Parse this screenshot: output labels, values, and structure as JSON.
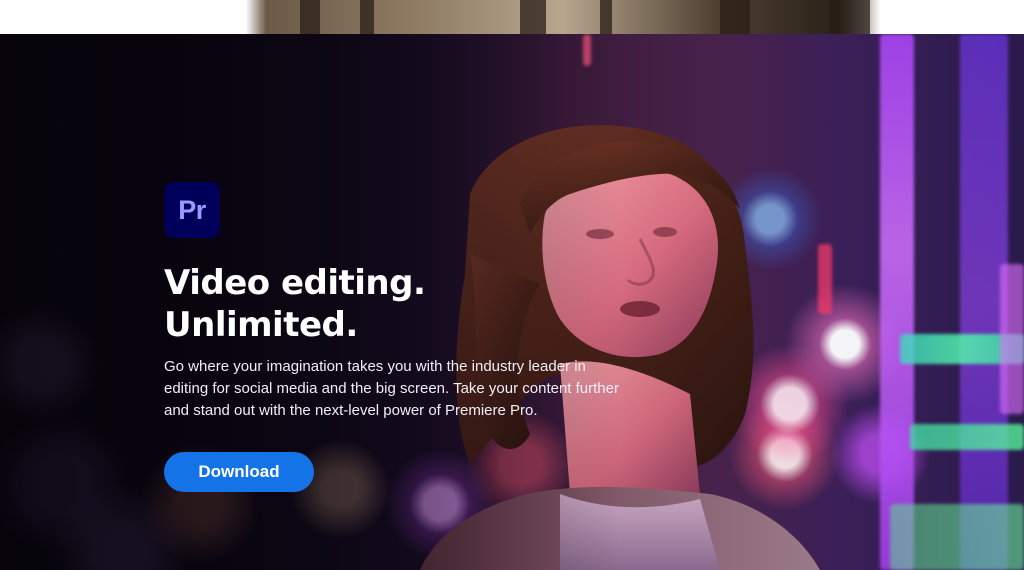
{
  "hero": {
    "app_icon": {
      "text": "Pr",
      "icon": "premiere-pro-icon",
      "background_color": "#00005b",
      "text_color": "#9999ff"
    },
    "headline": {
      "line1": "Video editing.",
      "line2": "Unlimited."
    },
    "description": "Go where your imagination takes you with the industry leader in editing for social media and the big screen. Take your content further and stand out with the next-level power of Premiere Pro.",
    "download_label": "Download",
    "accent_color": "#1473e6"
  }
}
